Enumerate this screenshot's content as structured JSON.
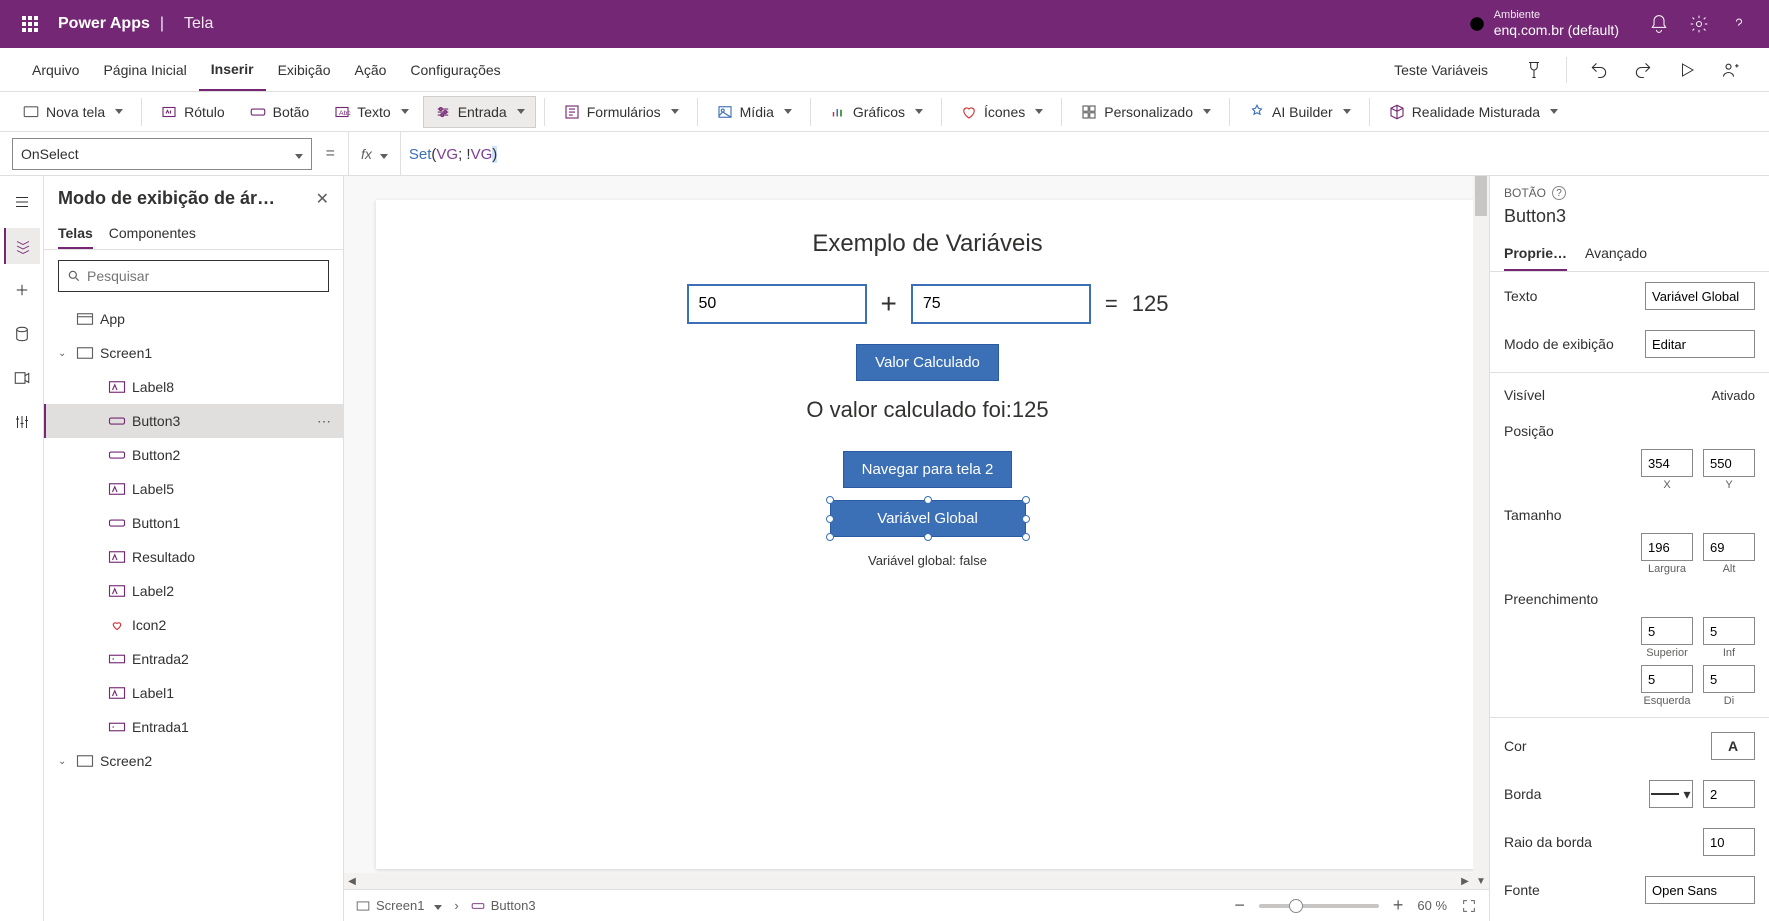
{
  "header": {
    "app_title": "Power Apps",
    "separator": "|",
    "page_title": "Tela",
    "env_label": "Ambiente",
    "env_name": "enq.com.br (default)"
  },
  "menu": {
    "items": [
      "Arquivo",
      "Página Inicial",
      "Inserir",
      "Exibição",
      "Ação",
      "Configurações"
    ],
    "active_index": 2,
    "right_label": "Teste Variáveis"
  },
  "ribbon": {
    "items": [
      {
        "label": "Nova tela",
        "dropdown": true
      },
      {
        "label": "Rótulo"
      },
      {
        "label": "Botão"
      },
      {
        "label": "Texto",
        "dropdown": true
      },
      {
        "label": "Entrada",
        "dropdown": true,
        "active": true
      },
      {
        "label": "Formulários",
        "dropdown": true
      },
      {
        "label": "Mídia",
        "dropdown": true
      },
      {
        "label": "Gráficos",
        "dropdown": true
      },
      {
        "label": "Ícones",
        "dropdown": true
      },
      {
        "label": "Personalizado",
        "dropdown": true
      },
      {
        "label": "AI Builder",
        "dropdown": true
      },
      {
        "label": "Realidade Misturada",
        "dropdown": true
      }
    ]
  },
  "formula": {
    "property": "OnSelect",
    "fx": "fx",
    "fn": "Set",
    "open": "(",
    "var1": "VG",
    "sep": ";  !",
    "var2": "VG",
    "close": ")"
  },
  "tree": {
    "title": "Modo de exibição de ár…",
    "tabs": [
      "Telas",
      "Componentes"
    ],
    "active_tab": 0,
    "search_placeholder": "Pesquisar",
    "app": "App",
    "screen1": "Screen1",
    "selected": "Button3",
    "children": [
      "Label8",
      "Button3",
      "Button2",
      "Label5",
      "Button1",
      "Resultado",
      "Label2",
      "Icon2",
      "Entrada2",
      "Label1",
      "Entrada1"
    ],
    "screen2": "Screen2"
  },
  "canvas": {
    "title": "Exemplo de Variáveis",
    "input1": "50",
    "input2": "75",
    "plus": "+",
    "eq": "=",
    "result": "125",
    "btn_calc": "Valor Calculado",
    "calc_text": "O valor calculado foi:125",
    "btn_nav": "Navegar para tela 2",
    "btn_var": "Variável Global",
    "var_label": "Variável global: false"
  },
  "status": {
    "screen": "Screen1",
    "control": "Button3",
    "zoom": "60",
    "zoom_unit": "%"
  },
  "props": {
    "type": "BOTÃO",
    "name": "Button3",
    "tabs": [
      "Proprie…",
      "Avançado"
    ],
    "active_tab": 0,
    "text_label": "Texto",
    "text_value": "Variável Global",
    "display_label": "Modo de exibição",
    "display_value": "Editar",
    "visible_label": "Visível",
    "visible_value": "Ativado",
    "position_label": "Posição",
    "pos_x": "354",
    "pos_y": "550",
    "pos_x_lbl": "X",
    "pos_y_lbl": "Y",
    "size_label": "Tamanho",
    "width": "196",
    "height": "69",
    "width_lbl": "Largura",
    "height_lbl": "Alt",
    "padding_label": "Preenchimento",
    "pad_top": "5",
    "pad_bot": "5",
    "pad_left": "5",
    "pad_right": "5",
    "pad_top_lbl": "Superior",
    "pad_bot_lbl": "Inf",
    "pad_left_lbl": "Esquerda",
    "pad_right_lbl": "Di",
    "color_label": "Cor",
    "border_label": "Borda",
    "border_width": "2",
    "radius_label": "Raio da borda",
    "radius_value": "10",
    "font_label": "Fonte",
    "font_value": "Open Sans"
  }
}
